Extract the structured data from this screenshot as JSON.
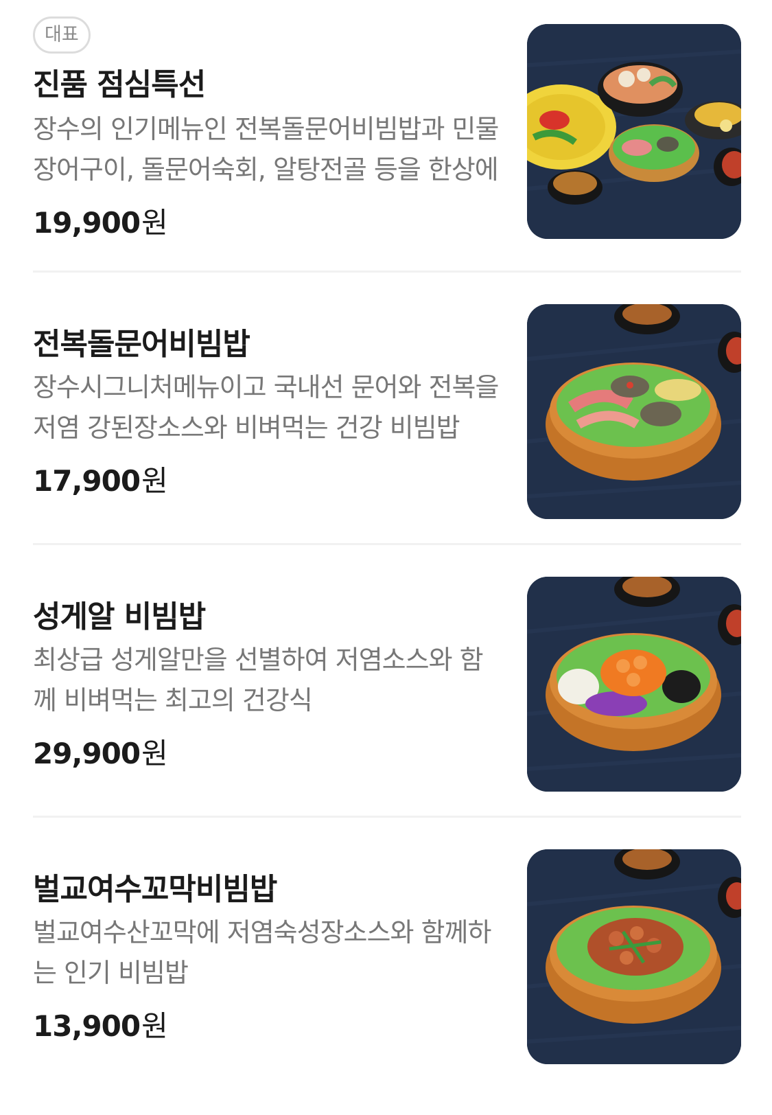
{
  "menu": {
    "items": [
      {
        "badge": "대표",
        "name": "진품 점심특선",
        "description": "장수의 인기메뉴인 전복돌문어비빔밥과 민물장어구이, 돌문어숙회, 알탕전골 등을 한상에",
        "price": "19,900",
        "currency": "원",
        "image": "lunch-special-spread-photo"
      },
      {
        "name": "전복돌문어비빔밥",
        "description": "장수시그니처메뉴이고 국내선 문어와 전복을 저염 강된장소스와 비벼먹는 건강 비빔밥",
        "price": "17,900",
        "currency": "원",
        "image": "abalone-octopus-bibimbap-photo"
      },
      {
        "name": "성게알 비빔밥",
        "description": "최상급 성게알만을 선별하여 저염소스와 함께 비벼먹는 최고의 건강식",
        "price": "29,900",
        "currency": "원",
        "image": "sea-urchin-bibimbap-photo"
      },
      {
        "name": "벌교여수꼬막비빔밥",
        "description": "벌교여수산꼬막에 저염숙성장소스와 함께하는 인기 비빔밥",
        "price": "13,900",
        "currency": "원",
        "image": "cockle-bibimbap-photo"
      }
    ]
  },
  "colors": {
    "background": "#ffffff",
    "title": "#1b1b1b",
    "description": "#777777",
    "badge_border": "#dcdcdc",
    "photo_background": "#22324a"
  }
}
